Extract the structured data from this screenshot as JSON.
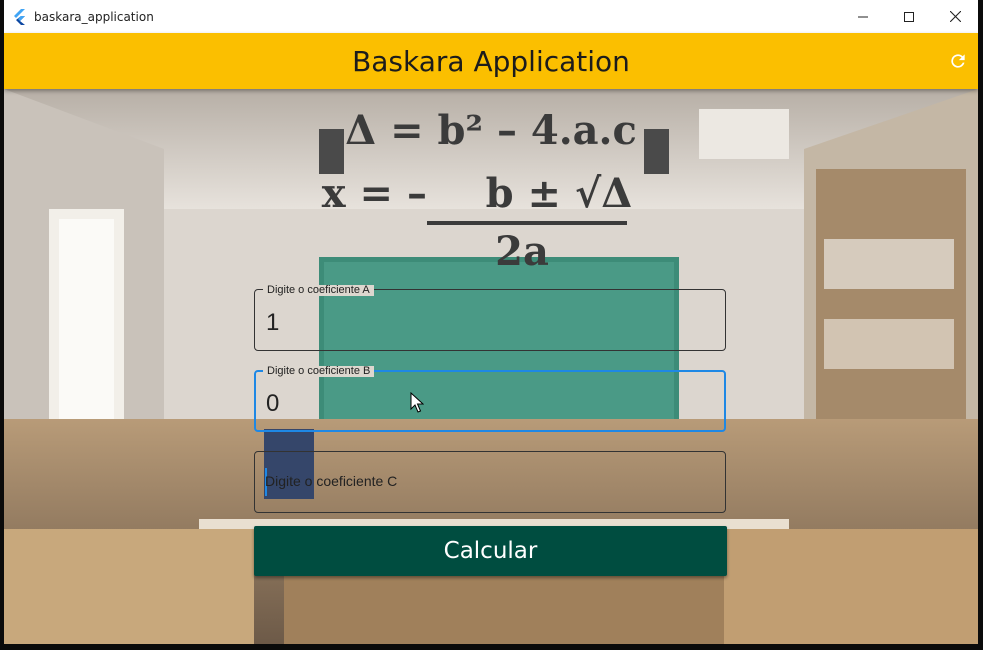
{
  "window": {
    "title": "baskara_application"
  },
  "appbar": {
    "title": "Baskara Application",
    "icon": "refresh-icon"
  },
  "formula": {
    "delta_line": "Δ = b² – 4.a.c",
    "x_prefix": "x = –",
    "x_numerator": "b ± √Δ",
    "x_denominator": "2a"
  },
  "fields": [
    {
      "label": "Digite o coeficiente A",
      "value": "1"
    },
    {
      "label": "Digite o coeficiente B",
      "value": "0"
    },
    {
      "placeholder": "Digite o coeficiente C",
      "value": ""
    }
  ],
  "button": {
    "label": "Calcular"
  },
  "colors": {
    "appbar": "#fbbf00",
    "button": "#004d40",
    "focus": "#1e88e5"
  }
}
